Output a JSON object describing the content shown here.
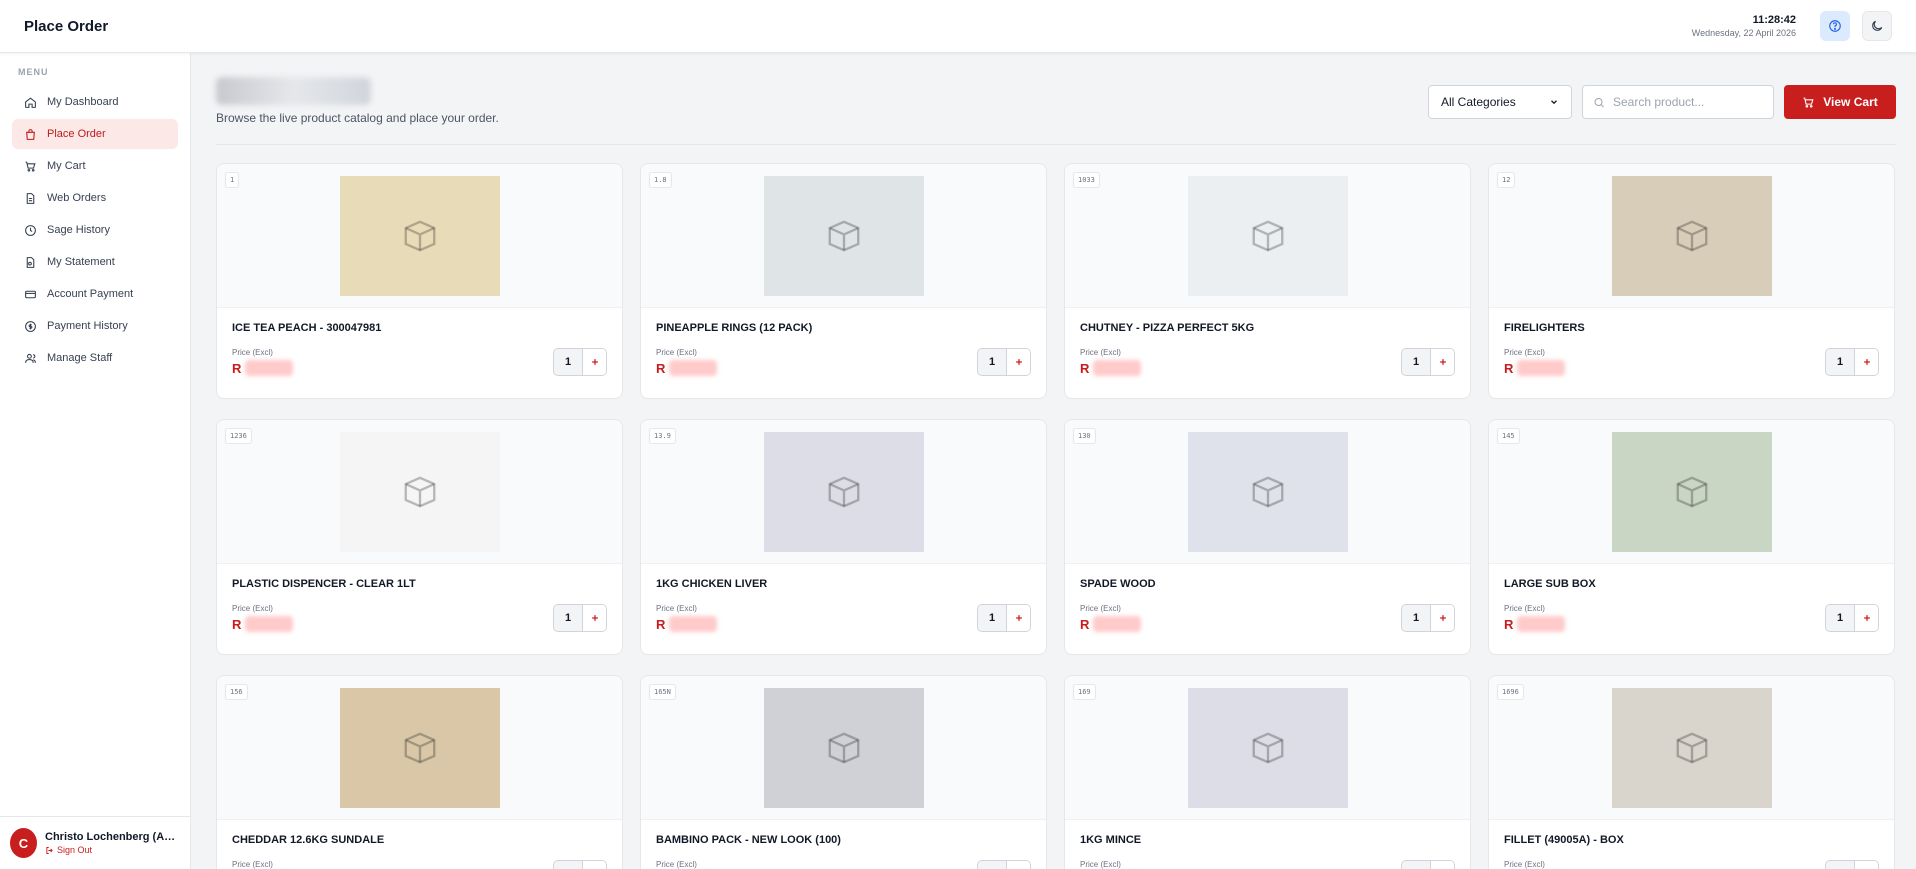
{
  "app": {
    "page_title": "Place Order"
  },
  "clock": {
    "time": "11:28:42",
    "date": "Wednesday, 22 April 2026"
  },
  "sidebar": {
    "menu_label": "MENU",
    "items": [
      {
        "label": "My Dashboard",
        "icon": "home-icon"
      },
      {
        "label": "Place Order",
        "icon": "shopping-bag-icon",
        "active": true
      },
      {
        "label": "My Cart",
        "icon": "cart-icon"
      },
      {
        "label": "Web Orders",
        "icon": "document-icon"
      },
      {
        "label": "Sage History",
        "icon": "clock-icon"
      },
      {
        "label": "My Statement",
        "icon": "statement-icon"
      },
      {
        "label": "Account Payment",
        "icon": "credit-card-icon"
      },
      {
        "label": "Payment History",
        "icon": "dollar-circle-icon"
      },
      {
        "label": "Manage Staff",
        "icon": "users-icon"
      }
    ]
  },
  "user": {
    "initial": "C",
    "name": "Christo Lochenberg (Ad...",
    "sign_out": "Sign Out"
  },
  "catalog": {
    "subtitle": "Browse the live product catalog and place your order.",
    "category_select": "All Categories",
    "search_placeholder": "Search product...",
    "view_cart": "View Cart",
    "price_label": "Price (Excl)",
    "currency": "R",
    "default_qty": "1"
  },
  "products": [
    {
      "code": "1",
      "name": "ICE TEA PEACH - 300047981"
    },
    {
      "code": "1.8",
      "name": "PINEAPPLE RINGS (12 PACK)"
    },
    {
      "code": "1033",
      "name": "CHUTNEY - PIZZA PERFECT 5KG"
    },
    {
      "code": "12",
      "name": "FIRELIGHTERS"
    },
    {
      "code": "1236",
      "name": "PLASTIC DISPENCER - CLEAR 1LT"
    },
    {
      "code": "13.9",
      "name": "1KG CHICKEN LIVER"
    },
    {
      "code": "130",
      "name": "SPADE WOOD"
    },
    {
      "code": "145",
      "name": "LARGE SUB BOX"
    },
    {
      "code": "156",
      "name": "CHEDDAR 12.6KG SUNDALE"
    },
    {
      "code": "165N",
      "name": "BAMBINO PACK - NEW LOOK (100)"
    },
    {
      "code": "169",
      "name": "1KG MINCE"
    },
    {
      "code": "1696",
      "name": "FILLET (49005A) - BOX"
    }
  ],
  "colors": {
    "brand": "#c81e1e",
    "active_bg": "#fde8e8"
  }
}
